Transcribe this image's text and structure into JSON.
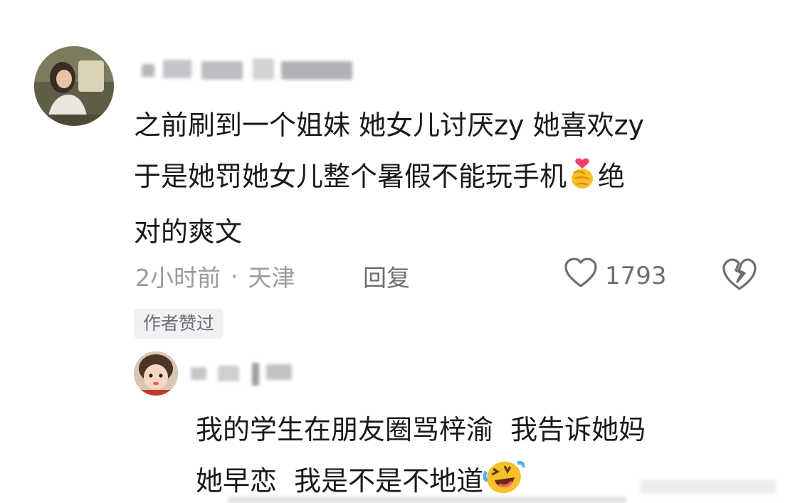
{
  "comment": {
    "text_line1": "之前刷到一个姐妹 她女儿讨厌zy 她喜欢zy",
    "text_line2": "于是她罚她女儿整个暑假不能玩手机",
    "text_line2_tail": "绝",
    "text_line3": "对的爽文",
    "time": "2小时前",
    "separator": "·",
    "location": "天津",
    "reply_label": "回复",
    "like_count": "1793",
    "author_badge": "作者赞过",
    "emoji_icon": "finger-heart-emoji",
    "like_icon": "heart-outline-icon",
    "dislike_icon": "broken-heart-icon"
  },
  "reply": {
    "text_line1": "我的学生在朋友圈骂梓渝  我告诉她妈",
    "text_line2": "她早恋  我是不是不地道",
    "emoji_icon": "laughing-crying-emoji"
  },
  "colors": {
    "text": "#1a1a1a",
    "meta": "#9a9a9f",
    "badge_bg": "#f1f1f3"
  }
}
